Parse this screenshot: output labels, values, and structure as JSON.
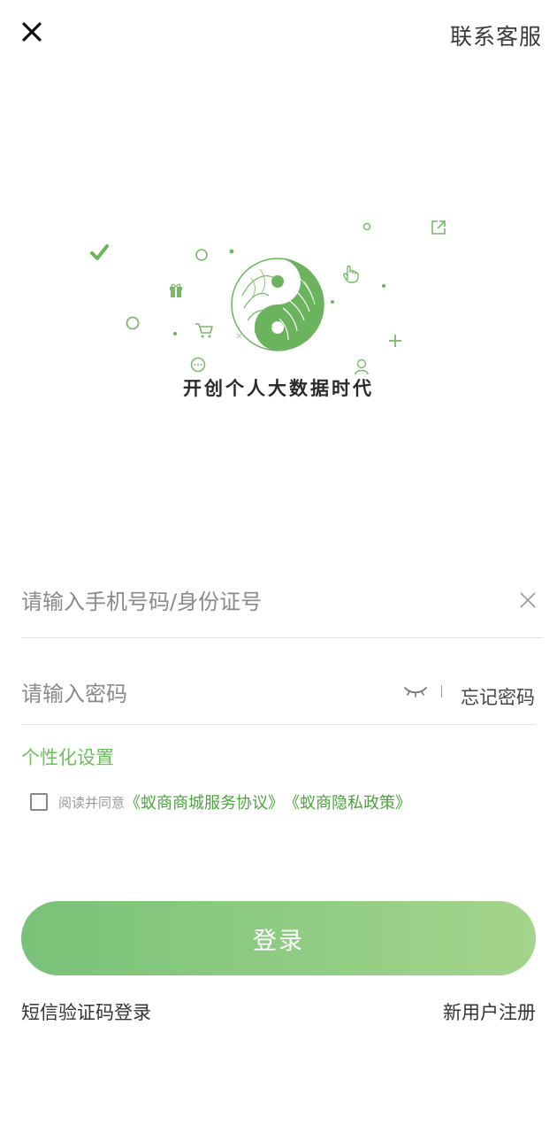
{
  "header": {
    "close_icon": "close-icon",
    "contact_label": "联系客服"
  },
  "hero": {
    "slogan": "开创个人大数据时代",
    "accent_color": "#6cb35e"
  },
  "form": {
    "phone_placeholder": "请输入手机号码/身份证号",
    "password_placeholder": "请输入密码",
    "forgot_label": "忘记密码",
    "personalize_label": "个性化设置",
    "agree_prefix": "阅读并同意",
    "agreement_1": "《蚁商商城服务协议》",
    "agreement_2": "《蚁商隐私政策》",
    "agree_checked": false
  },
  "actions": {
    "login_label": "登录",
    "sms_login_label": "短信验证码登录",
    "register_label": "新用户注册"
  },
  "colors": {
    "brand_green": "#6cbf5c",
    "link_green": "#4aa33c",
    "button_gradient_start": "#79c278",
    "button_gradient_end": "#a4d48c"
  }
}
